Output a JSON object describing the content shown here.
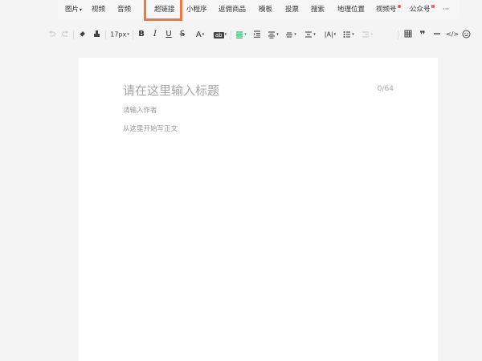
{
  "insert_toolbar": {
    "image": "图片",
    "video": "视频",
    "audio": "音频",
    "hyperlink": "超链接",
    "mini_program": "小程序",
    "commission_goods": "返佣商品",
    "template": "模板",
    "vote": "投票",
    "search": "搜索",
    "location": "地理位置",
    "channels": "视频号",
    "official_account": "公众号",
    "more": "···"
  },
  "format_toolbar": {
    "font_size": "17px",
    "font_color_label": "A",
    "bg_color_label": "ab"
  },
  "editor": {
    "title_placeholder": "请在这里输入标题",
    "title_counter": "0/64",
    "author_placeholder": "请输入作者",
    "body_placeholder": "从这里开始写正文"
  },
  "colors": {
    "highlight_box": "#f0783c",
    "notification_dot": "#fa5151",
    "active_align": "#07c160"
  }
}
